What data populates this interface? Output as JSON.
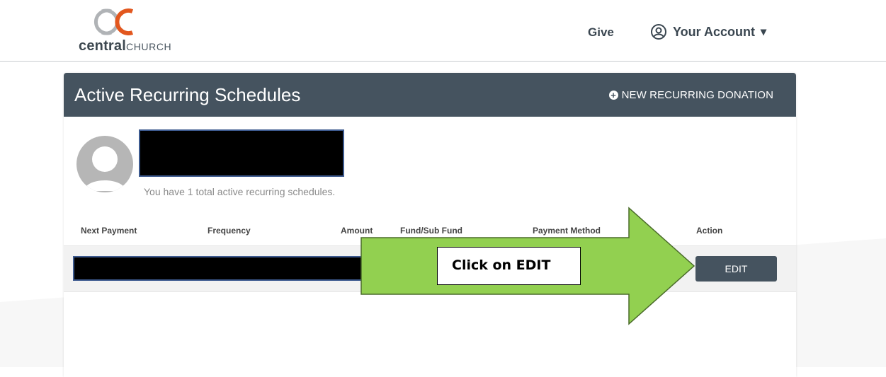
{
  "header": {
    "logo_bold": "central",
    "logo_light": "CHURCH",
    "give_label": "Give",
    "account_label": "Your Account",
    "account_caret": "▾"
  },
  "card": {
    "title": "Active Recurring Schedules",
    "new_button_label": "NEW RECURRING DONATION",
    "summary": "You have 1 total active recurring schedules.",
    "columns": [
      "Next Payment",
      "Frequency",
      "Amount",
      "Fund/Sub Fund",
      "Payment Method",
      "Action"
    ],
    "edit_label": "EDIT"
  },
  "annotation": {
    "callout_text": "Click on EDIT",
    "arrow_color": "#92d050",
    "arrow_border": "#4a6b2a"
  },
  "colors": {
    "header_bg": "#45535f",
    "logo_orange": "#e2571e",
    "logo_gray": "#b0b3b6"
  }
}
